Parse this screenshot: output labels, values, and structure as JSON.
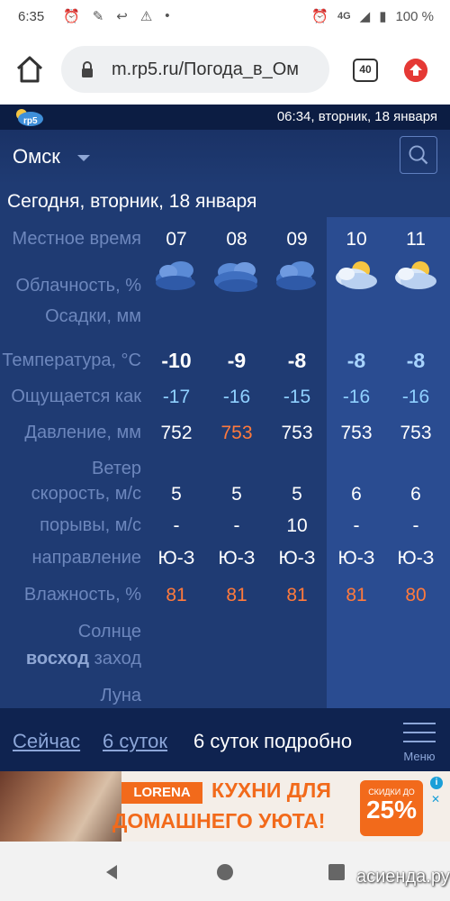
{
  "status_bar": {
    "time": "6:35",
    "network": "4G",
    "battery": "100 %"
  },
  "browser": {
    "url": "m.rp5.ru/Погода_в_Ом",
    "tab_count": "40"
  },
  "app": {
    "logo_text": "rp5",
    "header_datetime": "06:34, вторник, 18 января",
    "city": "Омск",
    "today_title": "Сегодня, вторник, 18 января",
    "labels": {
      "local_time": "Местное время",
      "cloudiness": "Облачность, %",
      "precipitation": "Осадки, мм",
      "temperature": "Температура, °С",
      "feels_like": "Ощущается как",
      "pressure": "Давление, мм",
      "wind": "Ветер",
      "wind_speed": "скорость, м/с",
      "gusts": "порывы, м/с",
      "direction": "направление",
      "humidity": "Влажность, %",
      "sun": "Солнце",
      "sunrise": "восход",
      "sunset": "заход",
      "moon": "Луна"
    },
    "hours": [
      "07",
      "08",
      "09",
      "10",
      "11"
    ],
    "temperature": [
      "-10",
      "-9",
      "-8",
      "-8",
      "-8"
    ],
    "feels_like": [
      "-17",
      "-16",
      "-15",
      "-16",
      "-16"
    ],
    "pressure": [
      "752",
      "753",
      "753",
      "753",
      "753"
    ],
    "wind_speed": [
      "5",
      "5",
      "5",
      "6",
      "6"
    ],
    "gusts": [
      "-",
      "-",
      "10",
      "-",
      "-"
    ],
    "direction": [
      "Ю-З",
      "Ю-З",
      "Ю-З",
      "Ю-З",
      "Ю-З"
    ],
    "humidity": [
      "81",
      "81",
      "81",
      "81",
      "80"
    ],
    "cloud_icons": [
      "cloudy-night-icon",
      "overcast-icon",
      "cloudy-night-icon",
      "cloudy-sun-icon",
      "cloudy-sun-icon"
    ],
    "colors": {
      "background": "#1f3b73",
      "highlight_column": "#2a4c91",
      "warm_value": "#ff7a3c",
      "feels_like_value": "#8fd0ff"
    }
  },
  "nav": {
    "now": "Сейчас",
    "six_days": "6 суток",
    "six_days_detail": "6 суток подробно",
    "menu": "Меню"
  },
  "ad": {
    "brand": "LORENA",
    "line1": "КУХНИ ДЛЯ",
    "line2": "ДОМАШНЕГО УЮТА!",
    "badge_small": "СКИДКИ ДО",
    "badge_big": "25%"
  },
  "watermark": "асиенда.ру"
}
